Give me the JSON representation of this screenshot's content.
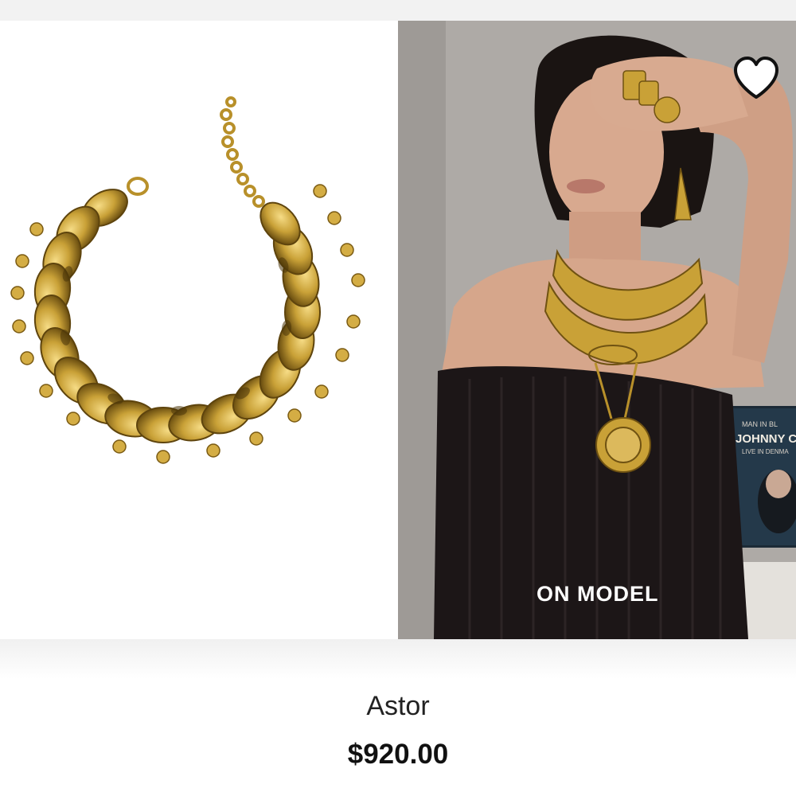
{
  "gallery": {
    "product_image_alt": "Astor gold chain bracelet",
    "model_image_label": "ON MODEL",
    "poster": {
      "line1": "MAN IN BL",
      "line2": "JOHNNY CA",
      "line3": "LIVE IN DENMA"
    }
  },
  "product": {
    "name": "Astor",
    "price": "$920.00"
  },
  "icons": {
    "favorite": "heart-outline-icon"
  },
  "colors": {
    "gold": "#c9a137",
    "gold_dark": "#8a6a1a",
    "sweater": "#1c1617",
    "text": "#111111"
  }
}
